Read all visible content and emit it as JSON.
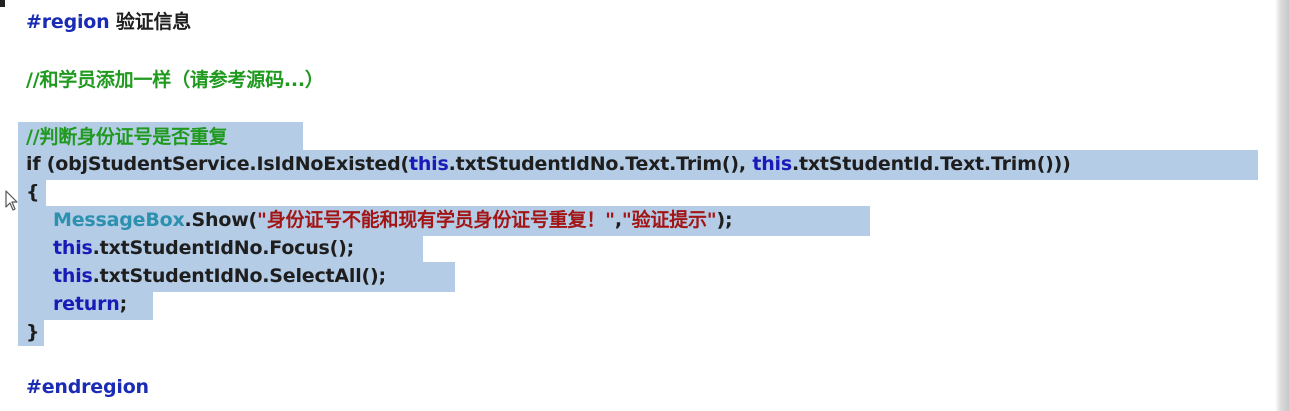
{
  "editor": {
    "region_start": {
      "directive": "#region",
      "name": "验证信息"
    },
    "comment1": "//和学员添加一样（请参考源码...）",
    "comment2": "//判断身份证号是否重复",
    "if_line": {
      "kw_if": "if",
      "p1": " (objStudentService.IsIdNoExisted(",
      "this1": "this",
      "p2": ".txtStudentIdNo.Text.Trim(), ",
      "this2": "this",
      "p3": ".txtStudentId.Text.Trim()))"
    },
    "brace_open": "{",
    "msg_line": {
      "type": "MessageBox",
      "p1": ".Show(",
      "str1": "\"身份证号不能和现有学员身份证号重复！\"",
      "comma": ",",
      "str2": "\"验证提示\"",
      "end": ");"
    },
    "focus_line": {
      "kw": "this",
      "rest": ".txtStudentIdNo.Focus();"
    },
    "selectall_line": {
      "kw": "this",
      "rest": ".txtStudentIdNo.SelectAll();"
    },
    "return_line": {
      "kw": "return",
      "rest": ";"
    },
    "brace_close": "}",
    "region_end": "#endregion"
  },
  "colors": {
    "selection": "#b4cce6",
    "keyword": "#1a1ab8",
    "comment": "#1f9a1f",
    "type": "#2b91af",
    "string": "#a31515"
  },
  "icons": {
    "cursor": "text-cursor-icon"
  }
}
